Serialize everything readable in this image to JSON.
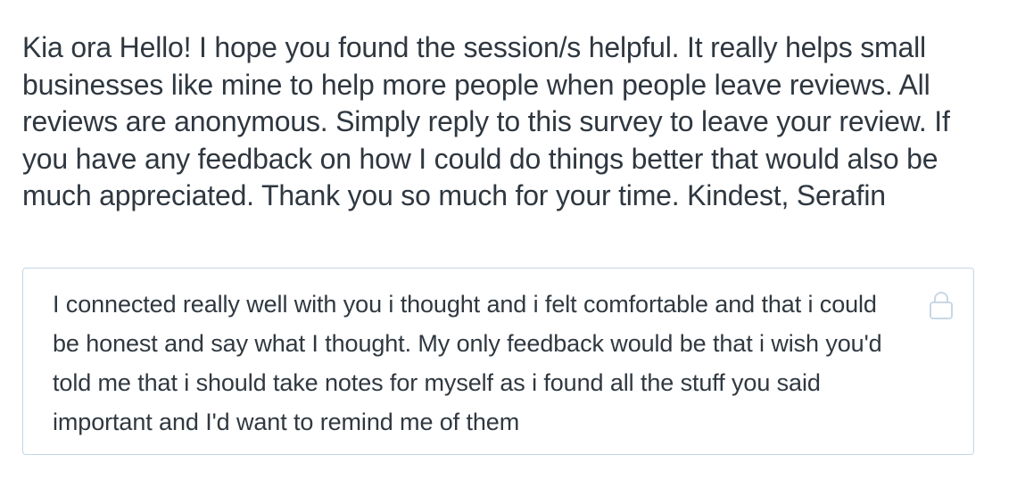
{
  "survey": {
    "question": "Kia ora Hello! I hope you found the session/s helpful. It really helps small businesses like mine to help more people when people leave reviews. All reviews are anonymous. Simply reply to this survey to leave your review. If you have any feedback on how I could do things better that would also be much appreciated. Thank you so much for your time. Kindest, Serafin",
    "answer": "I connected really well with you i thought and i felt comfortable and that i could be honest and say what I thought. My only feedback would be that i wish you'd told me that i should take notes for myself as i found all the stuff you said important and I'd want to remind me of them",
    "lock_icon": "lock-icon"
  },
  "colors": {
    "text": "#2f3740",
    "border": "#c4d6e6",
    "lock": "#c9d7e4",
    "background": "#ffffff"
  }
}
